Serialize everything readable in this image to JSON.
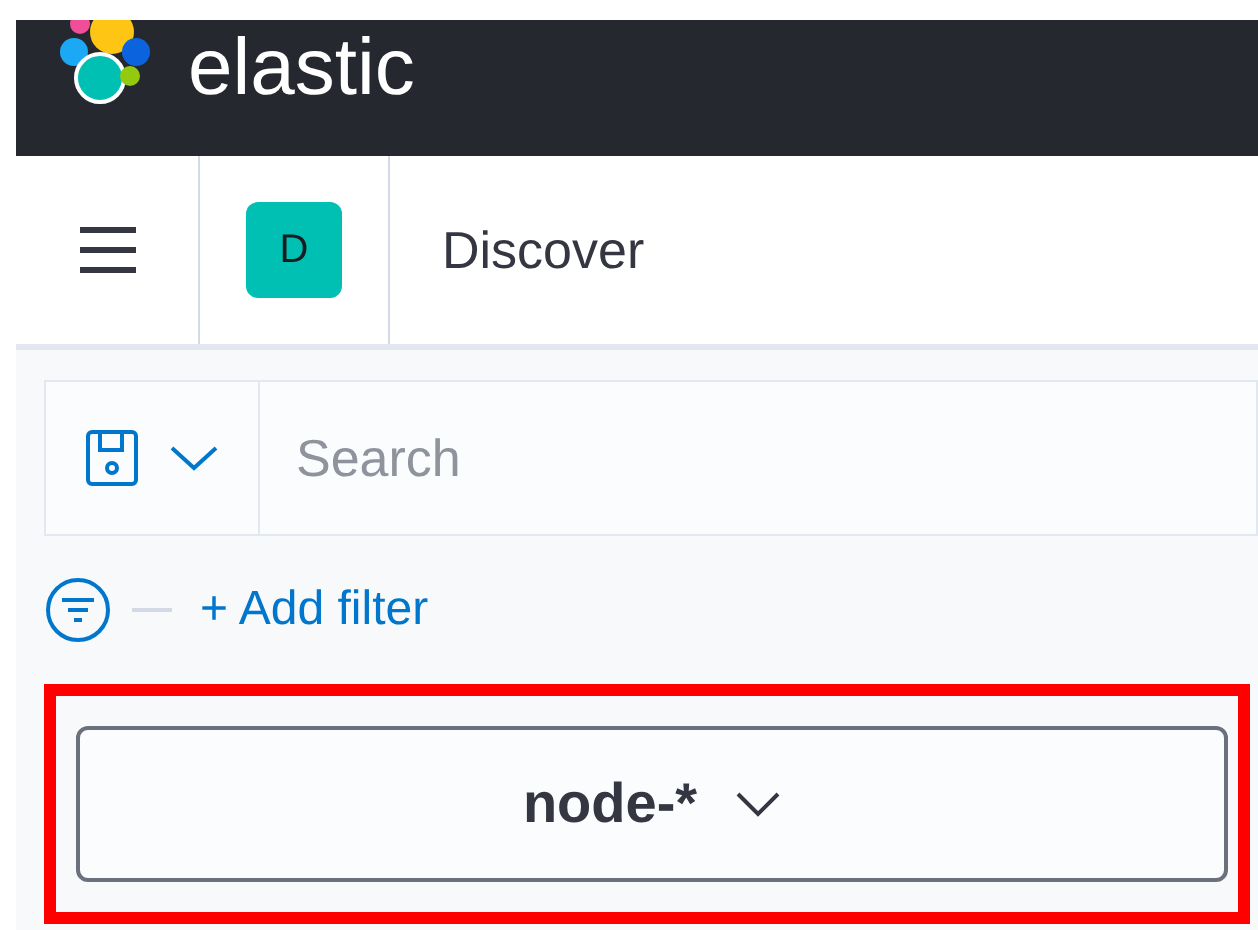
{
  "header": {
    "brand": "elastic"
  },
  "breadcrumb": {
    "app_badge": "D",
    "title": "Discover"
  },
  "query_bar": {
    "placeholder": "Search"
  },
  "filter_bar": {
    "add_filter": "+ Add filter"
  },
  "index_pattern": {
    "label": "node-*",
    "highlighted": true
  }
}
